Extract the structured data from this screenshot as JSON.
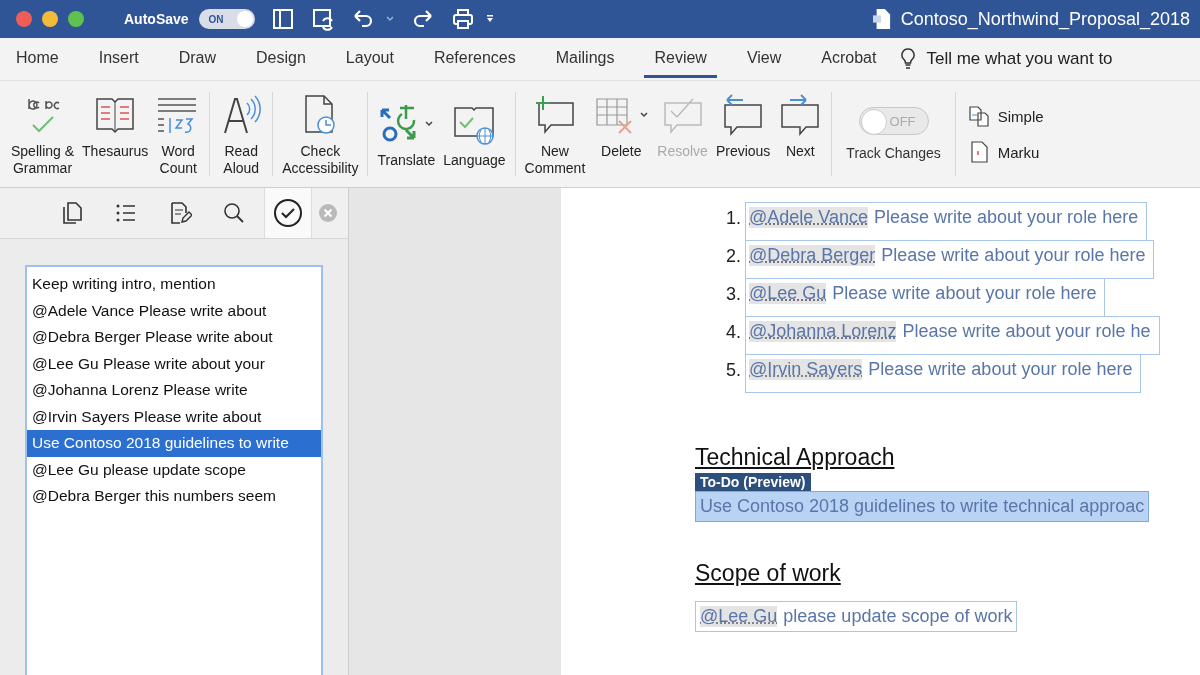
{
  "titlebar": {
    "autosave": {
      "label": "AutoSave",
      "on": true,
      "state_text": "ON"
    },
    "document_title": "Contoso_Northwind_Proposal_2018"
  },
  "tabs": [
    {
      "label": "Home",
      "selected": false
    },
    {
      "label": "Insert",
      "selected": false
    },
    {
      "label": "Draw",
      "selected": false
    },
    {
      "label": "Design",
      "selected": false
    },
    {
      "label": "Layout",
      "selected": false
    },
    {
      "label": "References",
      "selected": false
    },
    {
      "label": "Mailings",
      "selected": false
    },
    {
      "label": "Review",
      "selected": true
    },
    {
      "label": "View",
      "selected": false
    },
    {
      "label": "Acrobat",
      "selected": false
    }
  ],
  "tell_me": {
    "placeholder": "Tell me what you want to"
  },
  "ribbon": {
    "groups": [
      {
        "buttons": [
          {
            "kind": "spelling",
            "label": "Spelling &\nGrammar",
            "disabled": false,
            "has_menu": false
          },
          {
            "kind": "thesaurus",
            "label": "Thesaurus",
            "disabled": false,
            "has_menu": false
          },
          {
            "kind": "wordcount",
            "label": "Word\nCount",
            "disabled": false,
            "has_menu": false
          }
        ]
      },
      {
        "buttons": [
          {
            "kind": "readaloud",
            "label": "Read\nAloud",
            "disabled": false,
            "has_menu": false
          }
        ]
      },
      {
        "buttons": [
          {
            "kind": "accessibility",
            "label": "Check\nAccessibility",
            "disabled": false,
            "has_menu": false
          }
        ]
      },
      {
        "buttons": [
          {
            "kind": "translate",
            "label": "Translate",
            "disabled": false,
            "has_menu": true
          },
          {
            "kind": "language",
            "label": "Language",
            "disabled": false,
            "has_menu": false
          }
        ]
      },
      {
        "buttons": [
          {
            "kind": "newcomment",
            "label": "New\nComment",
            "disabled": false,
            "has_menu": false
          },
          {
            "kind": "delete",
            "label": "Delete",
            "disabled": false,
            "has_menu": true
          },
          {
            "kind": "resolve",
            "label": "Resolve",
            "disabled": true,
            "has_menu": false
          },
          {
            "kind": "previous",
            "label": "Previous",
            "disabled": false,
            "has_menu": false
          },
          {
            "kind": "next",
            "label": "Next",
            "disabled": false,
            "has_menu": false
          }
        ]
      }
    ],
    "track_changes": {
      "label": "Track Changes",
      "on": false,
      "state_text": "OFF"
    },
    "markup_options": [
      {
        "kind": "simple",
        "label": "Simple"
      },
      {
        "kind": "markup",
        "label": "Marku"
      }
    ]
  },
  "pane": {
    "tabs": [
      {
        "kind": "pages",
        "selected": false
      },
      {
        "kind": "outline",
        "selected": false
      },
      {
        "kind": "edit",
        "selected": false
      },
      {
        "kind": "search",
        "selected": false
      },
      {
        "kind": "todo",
        "selected": true
      }
    ],
    "items": [
      {
        "text": "Keep writing intro, mention",
        "selected": false
      },
      {
        "text": "@Adele Vance Please write about",
        "selected": false
      },
      {
        "text": "@Debra Berger Please write about",
        "selected": false
      },
      {
        "text": "@Lee Gu Please write about your",
        "selected": false
      },
      {
        "text": "@Johanna Lorenz Please write",
        "selected": false
      },
      {
        "text": "@Irvin Sayers Please write about",
        "selected": false
      },
      {
        "text": "Use Contoso 2018 guidelines to write",
        "selected": true
      },
      {
        "text": "@Lee Gu please update scope",
        "selected": false
      },
      {
        "text": "@Debra Berger this numbers seem",
        "selected": false
      }
    ]
  },
  "document": {
    "list": [
      {
        "number": "1.",
        "mention": "@Adele Vance",
        "text": "Please write about your role here"
      },
      {
        "number": "2.",
        "mention": "@Debra Berger",
        "text": "Please write about your role here"
      },
      {
        "number": "3.",
        "mention": "@Lee Gu",
        "text": "Please write about your role here"
      },
      {
        "number": "4.",
        "mention": "@Johanna Lorenz",
        "text": "Please write about your role he"
      },
      {
        "number": "5.",
        "mention": "@Irvin Sayers",
        "text": "Please write about your role here"
      }
    ],
    "sections": [
      {
        "heading": "Technical Approach",
        "badge": "To-Do (Preview)",
        "task": {
          "text": "Use Contoso 2018 guidelines to write technical approac",
          "selected": true
        }
      },
      {
        "heading": "Scope of work",
        "task": {
          "mention": "@Lee Gu",
          "text": "please update scope of work",
          "selected": false
        }
      }
    ]
  }
}
